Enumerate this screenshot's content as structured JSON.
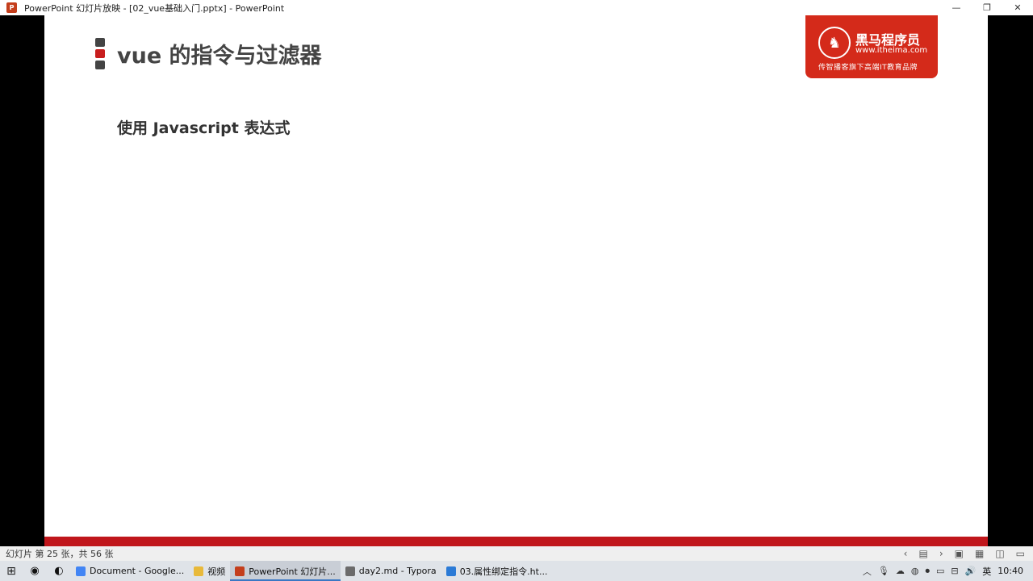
{
  "window": {
    "title": "PowerPoint 幻灯片放映 - [02_vue基础入门.pptx] - PowerPoint",
    "app_icon_letter": "P",
    "minimize": "—",
    "restore": "❐",
    "close": "✕"
  },
  "slide": {
    "title": "vue 的指令与过滤器",
    "subtitle": "使用 Javascript 表达式",
    "bullet_colors": [
      "#444444",
      "#c81e1e",
      "#444444"
    ],
    "logo": {
      "brand": "黑马程序员",
      "url": "www.itheima.com",
      "slogan": "传智播客旗下高端IT教育品牌"
    }
  },
  "statusbar": {
    "slide_info": "幻灯片 第 25 张，共 56 张"
  },
  "taskbar": {
    "items": [
      {
        "label": "Document - Google...",
        "icon_color": "#4285f4"
      },
      {
        "label": "视频",
        "icon_color": "#e8b93a"
      },
      {
        "label": "PowerPoint 幻灯片...",
        "icon_color": "#c43e1c"
      },
      {
        "label": "day2.md - Typora",
        "icon_color": "#6b6b6b"
      },
      {
        "label": "03.属性绑定指令.ht...",
        "icon_color": "#2a7ad6"
      }
    ],
    "ime": "英",
    "clock": "10:40"
  }
}
